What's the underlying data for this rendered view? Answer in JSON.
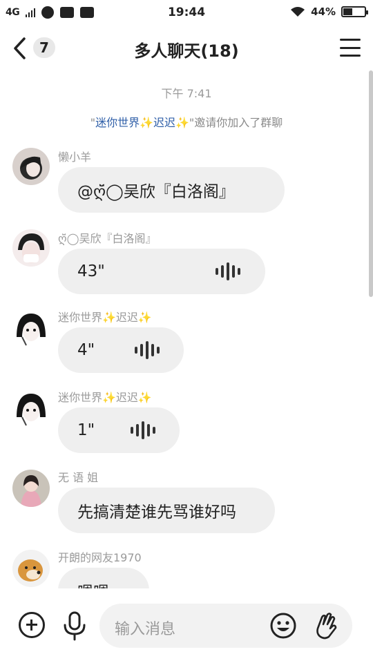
{
  "status_bar": {
    "network": "4G",
    "time": "19:44",
    "battery": "44%",
    "battery_level": 0.44
  },
  "header": {
    "unread_count": "7",
    "title": "多人聊天(18)"
  },
  "chat": {
    "time_separator": "下午 7:41",
    "system_message": {
      "quote_open": "\"",
      "inviter": "迷你世界✨迟迟✨",
      "quote_close": "\"",
      "text": "邀请你加入了群聊"
    },
    "messages": [
      {
        "sender": "懒小羊",
        "text": "@ღ̆̈◯吴欣『白洛阁』"
      },
      {
        "sender": "ღ̆̈◯吴欣『白洛阁』",
        "voice_duration": "43\""
      },
      {
        "sender": "迷你世界✨迟迟✨",
        "voice_duration": "4\""
      },
      {
        "sender": "迷你世界✨迟迟✨",
        "voice_duration": "1\""
      },
      {
        "sender": "无 语 姐",
        "text": "先搞清楚谁先骂谁好吗"
      },
      {
        "sender": "开朗的网友1970",
        "text": "嗯嗯"
      }
    ]
  },
  "input_bar": {
    "placeholder": "输入消息"
  },
  "icons": {
    "back": "chevron-left-icon",
    "menu": "menu-icon",
    "plus": "plus-circle-icon",
    "mic": "microphone-icon",
    "emoji": "smiley-icon",
    "gesture": "hand-wave-icon",
    "voice_wave": "voice-wave-icon"
  },
  "colors": {
    "accent_name": "#2f5fa8",
    "bubble_bg": "#efefef",
    "sparkle": "#e8b820"
  }
}
